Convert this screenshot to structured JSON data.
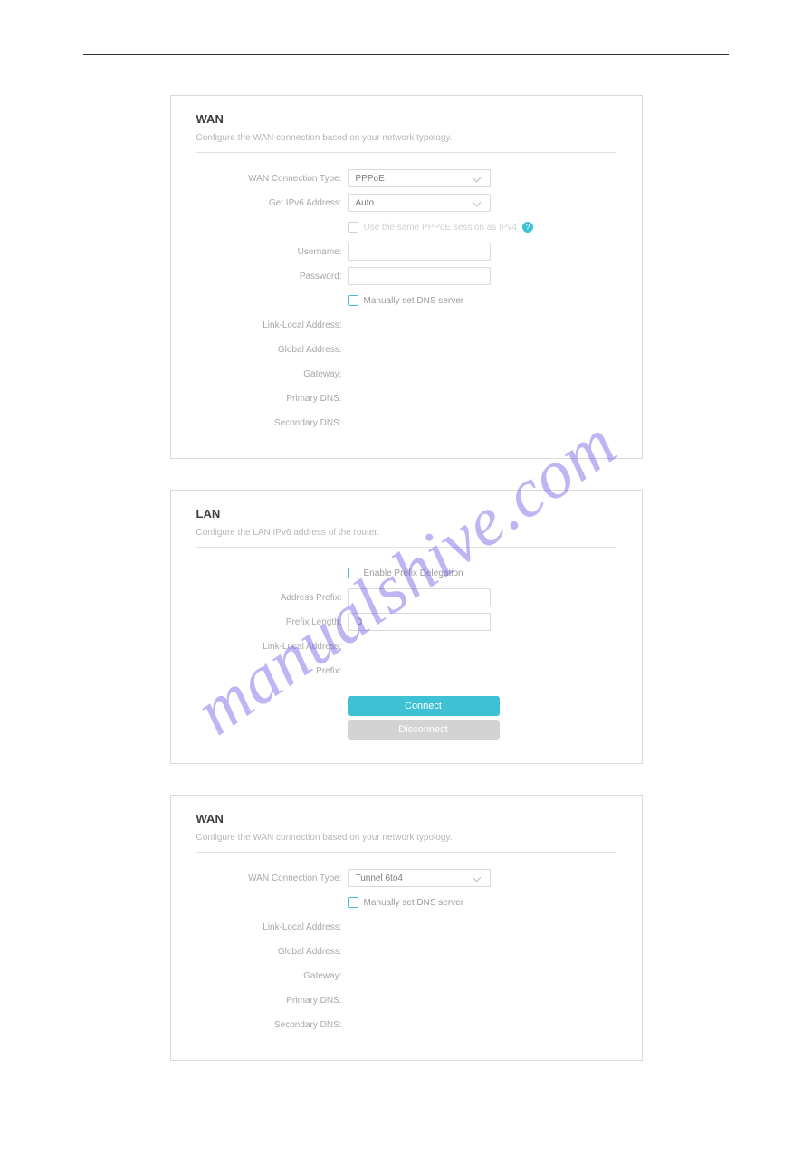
{
  "watermark": "manualshive.com",
  "wan1": {
    "title": "WAN",
    "subtitle": "Configure the WAN connection based on your network typology.",
    "fields": {
      "conn_type_label": "WAN Connection Type:",
      "conn_type_value": "PPPoE",
      "get_ipv6_label": "Get IPv6 Address:",
      "get_ipv6_value": "Auto",
      "same_pppoe_label": "Use the same PPPoE session as IPv4",
      "username_label": "Username:",
      "username_value": "",
      "password_label": "Password:",
      "password_value": "",
      "manual_dns_label": "Manually set DNS server",
      "link_local_label": "Link-Local Address:",
      "global_label": "Global Address:",
      "gateway_label": "Gateway:",
      "primary_dns_label": "Primary DNS:",
      "secondary_dns_label": "Secondary DNS:"
    }
  },
  "lan": {
    "title": "LAN",
    "subtitle": "Configure the LAN IPv6 address of the router.",
    "fields": {
      "enable_prefix_label": "Enable Prefix Delegation",
      "address_prefix_label": "Address Prefix:",
      "address_prefix_value": "",
      "prefix_length_label": "Prefix Length:",
      "prefix_length_value": "0",
      "link_local_label": "Link-Local Address:",
      "prefix_label": "Prefix:",
      "connect_btn": "Connect",
      "disconnect_btn": "Disconnect"
    }
  },
  "wan2": {
    "title": "WAN",
    "subtitle": "Configure the WAN connection based on your network typology.",
    "fields": {
      "conn_type_label": "WAN Connection Type:",
      "conn_type_value": "Tunnel 6to4",
      "manual_dns_label": "Manually set DNS server",
      "link_local_label": "Link-Local Address:",
      "global_label": "Global Address:",
      "gateway_label": "Gateway:",
      "primary_dns_label": "Primary DNS:",
      "secondary_dns_label": "Secondary DNS:"
    }
  }
}
